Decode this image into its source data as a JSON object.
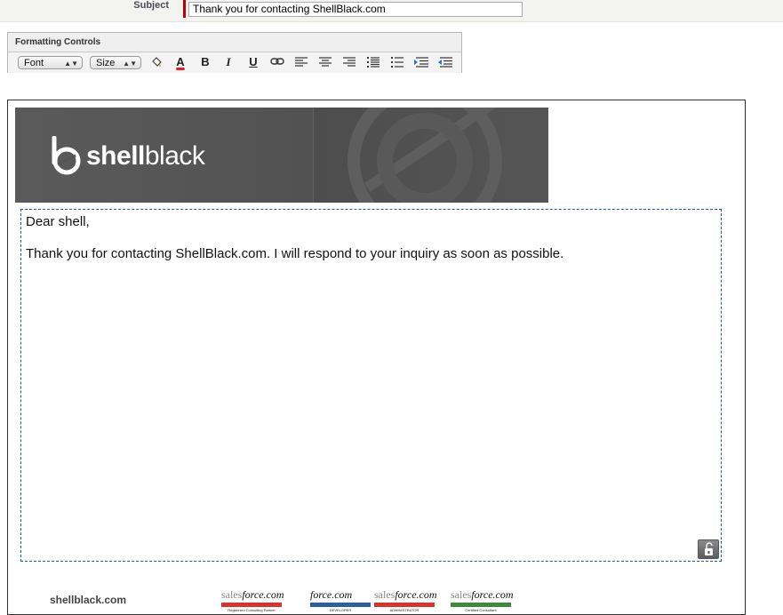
{
  "subject": {
    "label": "Subject",
    "value": "Thank you for contacting ShellBlack.com"
  },
  "formatting": {
    "title": "Formatting Controls",
    "font_select": "Font",
    "size_select": "Size",
    "buttons": {
      "bold": "B",
      "italic": "I",
      "underline": "U",
      "text_color": "A"
    }
  },
  "banner": {
    "brand_bold": "shell",
    "brand_light": "black"
  },
  "message": {
    "greeting": "Dear shell,",
    "body": "Thank you for contacting ShellBlack.com. I will respond to your inquiry as soon as possible."
  },
  "footer": {
    "site": "shellblack.com",
    "badges": [
      {
        "prefix": "sales",
        "word": "force.com",
        "sub": "Registered Consulting Partner",
        "color": "#d9342b"
      },
      {
        "prefix": "",
        "word": "force.com",
        "sub": "Certified",
        "sub2": "DEVELOPER",
        "color": "#2c5ea8"
      },
      {
        "prefix": "sales",
        "word": "force.com",
        "sub": "Certified",
        "sub2": "ADMINISTRATOR",
        "color": "#d9342b"
      },
      {
        "prefix": "sales",
        "word": "force.com",
        "sub": "Certified Consultant",
        "color": "#3c8a3a"
      }
    ]
  }
}
